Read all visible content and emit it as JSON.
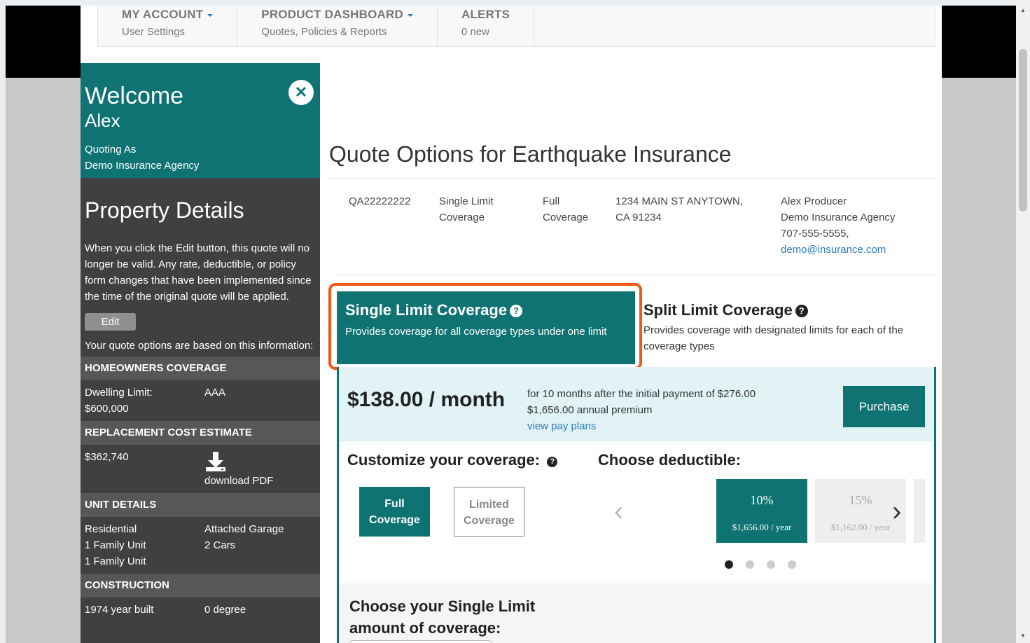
{
  "nav": [
    {
      "title": "MY ACCOUNT",
      "sub": "User Settings"
    },
    {
      "title": "PRODUCT DASHBOARD",
      "sub": "Quotes, Policies & Reports"
    },
    {
      "title": "ALERTS",
      "sub": "0 new"
    }
  ],
  "sidebar": {
    "welcome": "Welcome",
    "name": "Alex",
    "quoting_as": "Quoting As",
    "agency": "Demo Insurance Agency",
    "property_title": "Property Details",
    "edit_msg": "When you click the Edit button, this quote will no longer be valid. Any rate, deductible, or policy form changes that have been implemented since the time of the original quote will be applied.",
    "edit_label": "Edit",
    "basis": "Your quote options are based on this information:",
    "homeowners_head": "HOMEOWNERS COVERAGE",
    "dwelling_limit": "Dwelling Limit: $600,000",
    "dwelling_code": "AAA",
    "replacement_head": "REPLACEMENT COST ESTIMATE",
    "replacement_value": "$362,740",
    "download_label": "download PDF",
    "unit_head": "UNIT DETAILS",
    "unit_left": [
      "Residential",
      "1 Family Unit",
      "1 Family Unit"
    ],
    "unit_right": [
      "Attached Garage",
      "2 Cars"
    ],
    "construction_head": "CONSTRUCTION",
    "construction_left": "1974 year built",
    "construction_right": "0 degree"
  },
  "main": {
    "title": "Quote Options for Earthquake Insurance",
    "quote_id": "QA22222222",
    "limit_type": "Single Limit Coverage",
    "coverage": "Full Coverage",
    "address": "1234 MAIN ST ANYTOWN, CA 91234",
    "producer": "Alex Producer",
    "agency": "Demo Insurance Agency",
    "phone": "707-555-5555,",
    "email": "demo@insurance.com"
  },
  "tabs": {
    "single_title": "Single Limit Coverage",
    "single_desc": "Provides coverage for all coverage types under one limit",
    "split_title": "Split Limit Coverage",
    "split_desc": "Provides coverage with designated limits for each of the coverage types"
  },
  "pricing": {
    "monthly": "$138.00 / month",
    "line1": "for 10 months after the initial payment of $276.00",
    "line2": "$1,656.00 annual premium",
    "pay_plans": "view pay plans",
    "purchase": "Purchase"
  },
  "customize": {
    "label": "Customize your coverage:",
    "full": "Full Coverage",
    "limited": "Limited Coverage"
  },
  "deductible": {
    "label": "Choose deductible:",
    "options": [
      {
        "pct": "10%",
        "yearly": "$1,656.00 / year"
      },
      {
        "pct": "15%",
        "yearly": "$1,162.00 / year"
      }
    ],
    "page_count": 4,
    "active_page": 1
  },
  "single_limit": {
    "label": "Choose your Single Limit amount of coverage:"
  },
  "colors": {
    "brand_teal": "#0e7372",
    "highlight": "#f05a14",
    "price_bg": "#e1f3f5"
  }
}
